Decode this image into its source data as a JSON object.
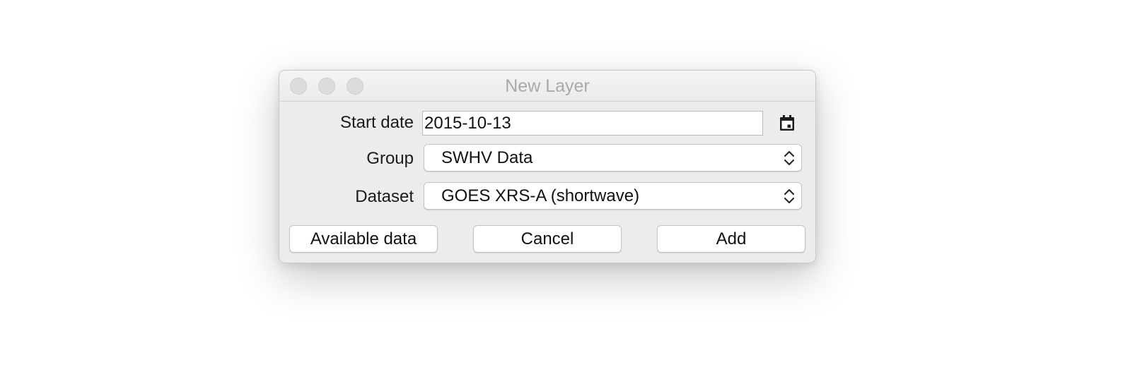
{
  "window": {
    "title": "New Layer"
  },
  "form": {
    "start_date": {
      "label": "Start date",
      "value": "2015-10-13",
      "icon": "calendar-icon"
    },
    "group": {
      "label": "Group",
      "value": "SWHV Data"
    },
    "dataset": {
      "label": "Dataset",
      "value": "GOES XRS-A (shortwave)"
    }
  },
  "buttons": {
    "available_data": "Available data",
    "cancel": "Cancel",
    "add": "Add"
  },
  "colors": {
    "window_bg": "#ececec",
    "title_text": "#a9a9a9",
    "traffic_light_inactive": "#dcdcdc"
  }
}
